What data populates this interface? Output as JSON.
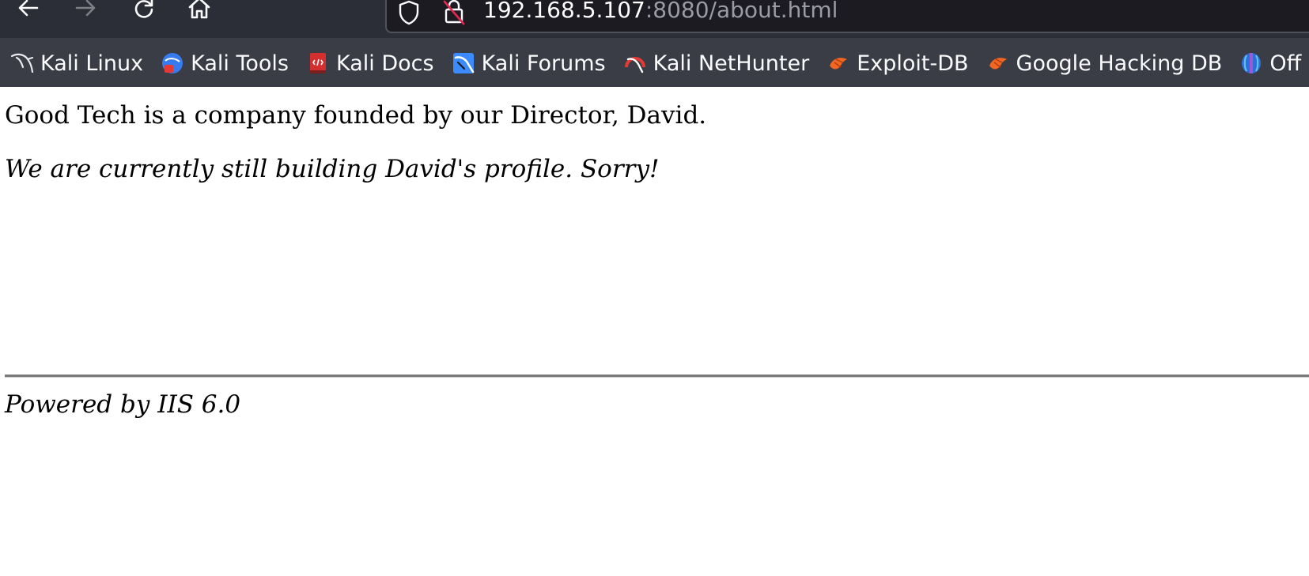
{
  "browser": {
    "nav": {
      "back_icon": "arrow-left-icon",
      "forward_icon": "arrow-right-icon",
      "reload_icon": "reload-icon",
      "home_icon": "home-icon"
    },
    "url": {
      "host": "192.168.5.107",
      "path": ":8080/about.html"
    },
    "bookmarks": [
      {
        "label": "Kali Linux",
        "icon": "kali-dragon-icon"
      },
      {
        "label": "Kali Tools",
        "icon": "kali-tools-icon"
      },
      {
        "label": "Kali Docs",
        "icon": "kali-docs-icon"
      },
      {
        "label": "Kali Forums",
        "icon": "kali-forums-icon"
      },
      {
        "label": "Kali NetHunter",
        "icon": "kali-nethunter-icon"
      },
      {
        "label": "Exploit-DB",
        "icon": "exploit-db-icon"
      },
      {
        "label": "Google Hacking DB",
        "icon": "ghdb-icon"
      },
      {
        "label": "Off",
        "icon": "offsec-icon"
      }
    ]
  },
  "page": {
    "intro": "Good Tech is a company founded by our Director, David.",
    "notice": "We are currently still building David's profile. Sorry!",
    "footer": "Powered by IIS 6.0"
  },
  "colors": {
    "toolbar": "#2b2e36",
    "bookmarks_bar": "#3a3d45",
    "url_bg": "#1c1b22",
    "url_path": "#9a9ca3",
    "hr": "#7a7a7a"
  }
}
